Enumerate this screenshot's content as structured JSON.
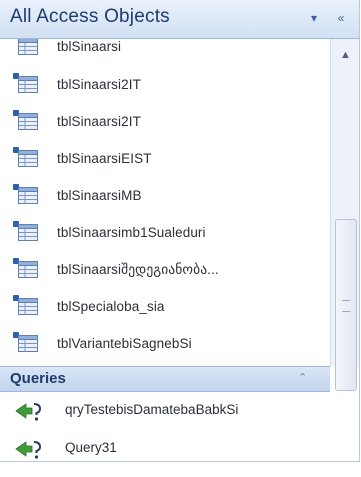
{
  "pane": {
    "title": "All Access Objects",
    "menu_glyph": "▾",
    "collapse_glyph": "«"
  },
  "tables": [
    {
      "label": "tblSinaarsi",
      "linked": false
    },
    {
      "label": "tblSinaarsi2IT",
      "linked": true
    },
    {
      "label": "tblSinaarsi2IT",
      "linked": true
    },
    {
      "label": "tblSinaarsiEIST",
      "linked": true
    },
    {
      "label": "tblSinaarsiMB",
      "linked": true
    },
    {
      "label": "tblSinaarsimb1Sualeduri",
      "linked": true
    },
    {
      "label": "tblSinaarsiშედეგიანობა...",
      "linked": true
    },
    {
      "label": "tblSpecialoba_sia",
      "linked": true
    },
    {
      "label": "tblVariantebiSagnebSi",
      "linked": true
    }
  ],
  "queries_section": {
    "label": "Queries",
    "chevron": "⌃"
  },
  "queries": [
    {
      "label": "qryTestebisDamatebaBabkSi"
    },
    {
      "label": "Query31"
    }
  ],
  "scrollbar": {
    "up_glyph": "▲"
  }
}
